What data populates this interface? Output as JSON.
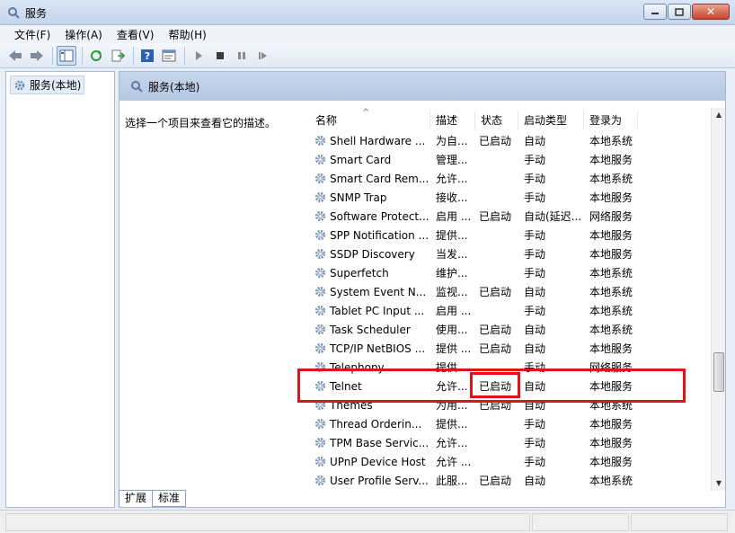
{
  "window": {
    "title": "服务"
  },
  "menu": [
    "文件(F)",
    "操作(A)",
    "查看(V)",
    "帮助(H)"
  ],
  "tree": {
    "root_label": "服务(本地)"
  },
  "pane": {
    "header_title": "服务(本地)",
    "description_hint": "选择一个项目来查看它的描述。"
  },
  "columns": {
    "name": "名称",
    "description": "描述",
    "status": "状态",
    "startup_type": "启动类型",
    "logon_as": "登录为"
  },
  "services": [
    {
      "name": "Shell Hardware ...",
      "description": "为自...",
      "status": "已启动",
      "startup_type": "自动",
      "logon_as": "本地系统"
    },
    {
      "name": "Smart Card",
      "description": "管理...",
      "status": "",
      "startup_type": "手动",
      "logon_as": "本地服务"
    },
    {
      "name": "Smart Card Rem...",
      "description": "允许...",
      "status": "",
      "startup_type": "手动",
      "logon_as": "本地系统"
    },
    {
      "name": "SNMP Trap",
      "description": "接收...",
      "status": "",
      "startup_type": "手动",
      "logon_as": "本地服务"
    },
    {
      "name": "Software Protect...",
      "description": "启用 ...",
      "status": "已启动",
      "startup_type": "自动(延迟...",
      "logon_as": "网络服务"
    },
    {
      "name": "SPP Notification ...",
      "description": "提供...",
      "status": "",
      "startup_type": "手动",
      "logon_as": "本地服务"
    },
    {
      "name": "SSDP Discovery",
      "description": "当发...",
      "status": "",
      "startup_type": "手动",
      "logon_as": "本地服务"
    },
    {
      "name": "Superfetch",
      "description": "维护...",
      "status": "",
      "startup_type": "手动",
      "logon_as": "本地系统"
    },
    {
      "name": "System Event N...",
      "description": "监视...",
      "status": "已启动",
      "startup_type": "自动",
      "logon_as": "本地系统"
    },
    {
      "name": "Tablet PC Input ...",
      "description": "启用 ...",
      "status": "",
      "startup_type": "手动",
      "logon_as": "本地系统"
    },
    {
      "name": "Task Scheduler",
      "description": "使用...",
      "status": "已启动",
      "startup_type": "自动",
      "logon_as": "本地系统"
    },
    {
      "name": "TCP/IP NetBIOS ...",
      "description": "提供 ...",
      "status": "已启动",
      "startup_type": "自动",
      "logon_as": "本地服务"
    },
    {
      "name": "Telephony",
      "description": "提供...",
      "status": "",
      "startup_type": "手动",
      "logon_as": "网络服务"
    },
    {
      "name": "Telnet",
      "description": "允许...",
      "status": "已启动",
      "startup_type": "自动",
      "logon_as": "本地服务"
    },
    {
      "name": "Themes",
      "description": "为用...",
      "status": "已启动",
      "startup_type": "自动",
      "logon_as": "本地系统"
    },
    {
      "name": "Thread Orderin...",
      "description": "提供...",
      "status": "",
      "startup_type": "手动",
      "logon_as": "本地服务"
    },
    {
      "name": "TPM Base Servic...",
      "description": "允许...",
      "status": "",
      "startup_type": "手动",
      "logon_as": "本地服务"
    },
    {
      "name": "UPnP Device Host",
      "description": "允许 ...",
      "status": "",
      "startup_type": "手动",
      "logon_as": "本地服务"
    },
    {
      "name": "User Profile Serv...",
      "description": "此服...",
      "status": "已启动",
      "startup_type": "自动",
      "logon_as": "本地系统"
    }
  ],
  "tabs": {
    "extended": "扩展",
    "standard": "标准"
  },
  "colors": {
    "highlight": "#e0121a",
    "header_bg": "#b4c8e1"
  },
  "icons": [
    "services-icon",
    "back-icon",
    "forward-icon",
    "show-tree-icon",
    "refresh-icon",
    "export-icon",
    "help-icon",
    "properties-icon",
    "start-icon",
    "stop-icon",
    "pause-icon",
    "restart-icon",
    "gear-icon"
  ]
}
